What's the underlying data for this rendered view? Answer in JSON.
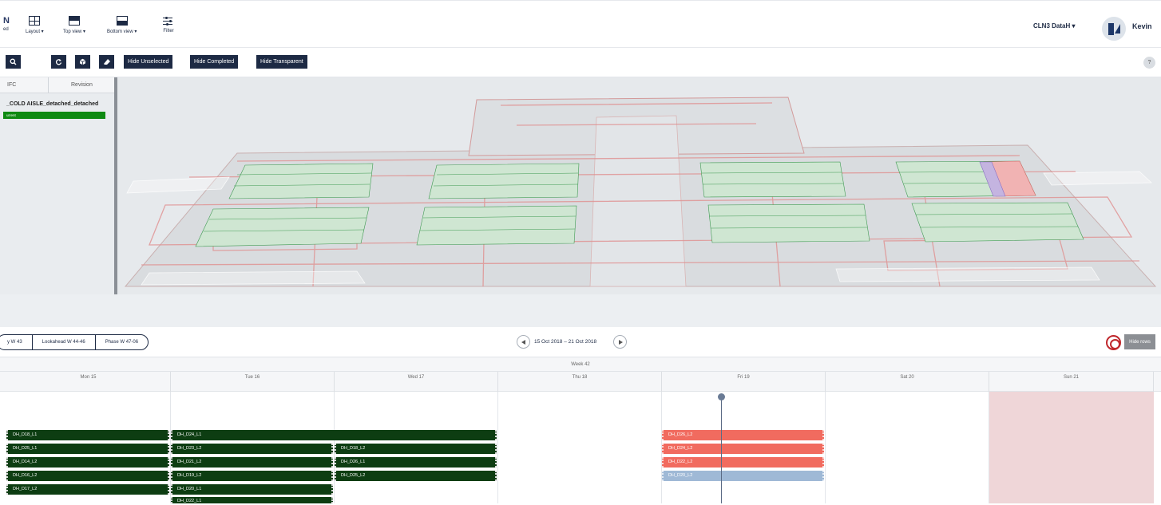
{
  "toolbar": {
    "edge_mark": "N",
    "edge_label": "ed",
    "layout_label": "Layout ▾",
    "top_view_label": "Top view ▾",
    "bottom_view_label": "Bottom view ▾",
    "filter_label": "Filter",
    "project": "CLN3 DataH ▾",
    "user": "Kevin"
  },
  "actions": {
    "search_icon": "search-icon",
    "buttons": [
      "Hide Unselected",
      "Hide Completed",
      "Hide Transparent"
    ],
    "help": "?"
  },
  "left_panel": {
    "col_ifc": "IFC",
    "col_revision": "Revision",
    "row_name": "_COLD AISLE_detached_detached",
    "row_status": "urrent"
  },
  "schedule": {
    "tabs": [
      "y  W 43",
      "Lookahead  W 44-46",
      "Phase  W 47-06"
    ],
    "date_range": "15 Oct 2018 – 21 Oct 2018",
    "hide_rows": "Hide rows",
    "week": "Week 42",
    "days": [
      "Mon 15",
      "Tue 16",
      "Wed 17",
      "Thu 18",
      "Fri 19",
      "Sat 20",
      "Sun 21"
    ]
  },
  "tasks": {
    "mon": [
      "DH_D18_L1",
      "DH_D25_L1",
      "DH_D14_L2",
      "DH_D16_L2",
      "DH_D17_L2"
    ],
    "tue": [
      "DH_D24_L1",
      "DH_D23_L2",
      "DH_D21_L2",
      "DH_D19_L2",
      "DH_D20_L1",
      "DH_D22_L1"
    ],
    "wed": [
      "DH_D18_L2",
      "DH_D26_L1",
      "DH_D25_L2"
    ],
    "fri": [
      "DH_D26_L2",
      "DH_D24_L2",
      "DH_D22_L2",
      "DH_D20_L2"
    ]
  },
  "colors": {
    "navy": "#1d2a44",
    "completed": "#0d3d12",
    "late": "#f16b5f",
    "planned": "#9fb9d6",
    "weekend": "#efd6d8"
  }
}
